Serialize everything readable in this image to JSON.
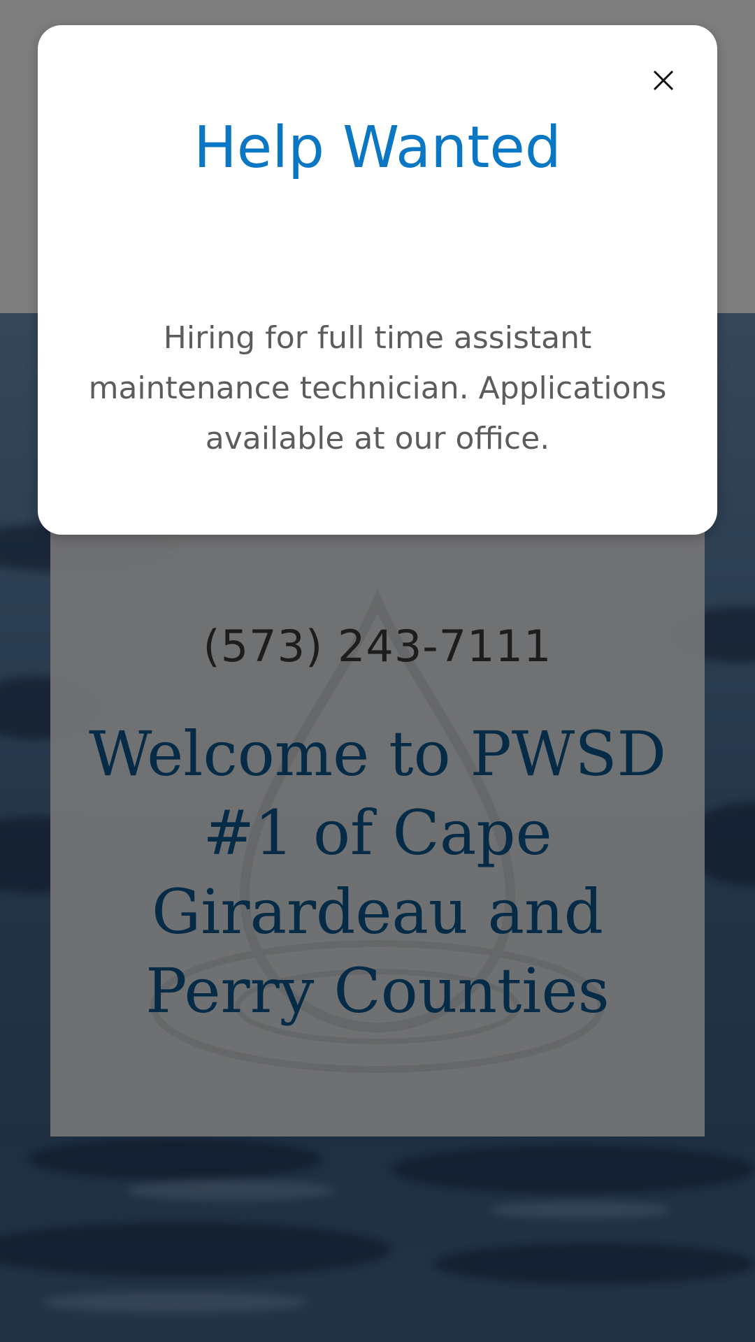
{
  "modal": {
    "title": "Help Wanted",
    "body": "Hiring for full time assistant maintenance technician. Applications available at our office.",
    "close_icon": "close-icon"
  },
  "hero": {
    "phone": "(573) 243-7111",
    "title": "Welcome to PWSD #1 of Cape Girardeau and Perry Counties"
  },
  "colors": {
    "modal_title": "#0a77c4",
    "hero_title": "#0b568f",
    "body_text": "#5c5c5c",
    "overlay": "rgba(0,0,0,0.5)"
  }
}
